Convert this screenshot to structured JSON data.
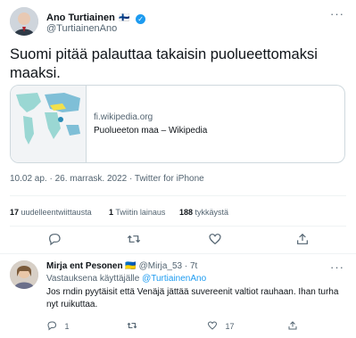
{
  "tweet": {
    "author_name": "Ano Turtiainen",
    "flag": "🇫🇮",
    "handle": "@TurtiainenAno",
    "text": "Suomi pitää palauttaa takaisin puolueettomaksi maaksi.",
    "card": {
      "domain": "fi.wikipedia.org",
      "title": "Puolueeton maa – Wikipedia"
    },
    "timestamp": "10.02 ap. · 26. marrask. 2022 · Twitter for iPhone",
    "stats": {
      "retweets_count": "17",
      "retweets_label": "uudelleentwiittausta",
      "quotes_count": "1",
      "quotes_label": "Twiitin lainaus",
      "likes_count": "188",
      "likes_label": "tykkäystä"
    }
  },
  "reply": {
    "author_name": "Mirja ent Pesonen",
    "flag": "🇺🇦",
    "handle": "@Mirja_53",
    "time": "· 7t",
    "replying_to_prefix": "Vastauksena käyttäjälle",
    "replying_to_handle": "@TurtiainenAno",
    "text": "Jos rndin pyytäisit että Venäjä jättää suvereenit valtiot rauhaan. Ihan turha nyt ruikuttaa.",
    "reply_count": "1",
    "retweet_count": "",
    "like_count": "17"
  },
  "colors": {
    "accent": "#1d9bf0",
    "muted": "#536471",
    "border": "#cfd9de"
  }
}
